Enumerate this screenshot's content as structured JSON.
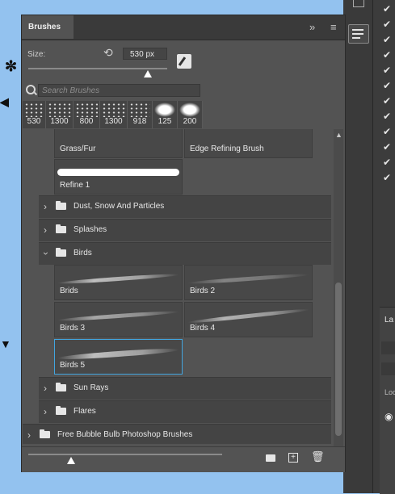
{
  "panel": {
    "title": "Brushes",
    "size_label": "Size:",
    "size_value": "530 px",
    "size_slider_fraction": 0.86,
    "search_placeholder": "Search Brushes"
  },
  "presets": [
    {
      "size": "530"
    },
    {
      "size": "1300"
    },
    {
      "size": "800"
    },
    {
      "size": "1300"
    },
    {
      "size": "918"
    },
    {
      "size": "125"
    },
    {
      "size": "200"
    }
  ],
  "brushes": {
    "grass_fur": "Grass/Fur",
    "edge_refining": "Edge Refining Brush",
    "refine_1": "Refine 1",
    "brids": "Brids",
    "birds_2": "Birds 2",
    "birds_3": "Birds 3",
    "birds_4": "Birds 4",
    "birds_5": "Birds 5"
  },
  "groups": {
    "dust": "Dust, Snow And Particles",
    "splashes": "Splashes",
    "birds": "Birds",
    "sun_rays": "Sun Rays",
    "flares": "Flares",
    "bubble": "Free Bubble Bulb Photoshop Brushes"
  },
  "icons": {
    "expand": "double-chevron-right-icon",
    "menu": "hamburger-menu-icon",
    "reset": "reset-icon",
    "brush_settings": "brush-settings-icon",
    "search": "search-icon",
    "new_group": "folder-icon",
    "new_brush": "plus-square-icon",
    "delete": "trash-icon"
  },
  "colors": {
    "accent_selection": "#42a5df",
    "panel_bg": "#535353",
    "canvas_bg": "#93c2ef"
  }
}
